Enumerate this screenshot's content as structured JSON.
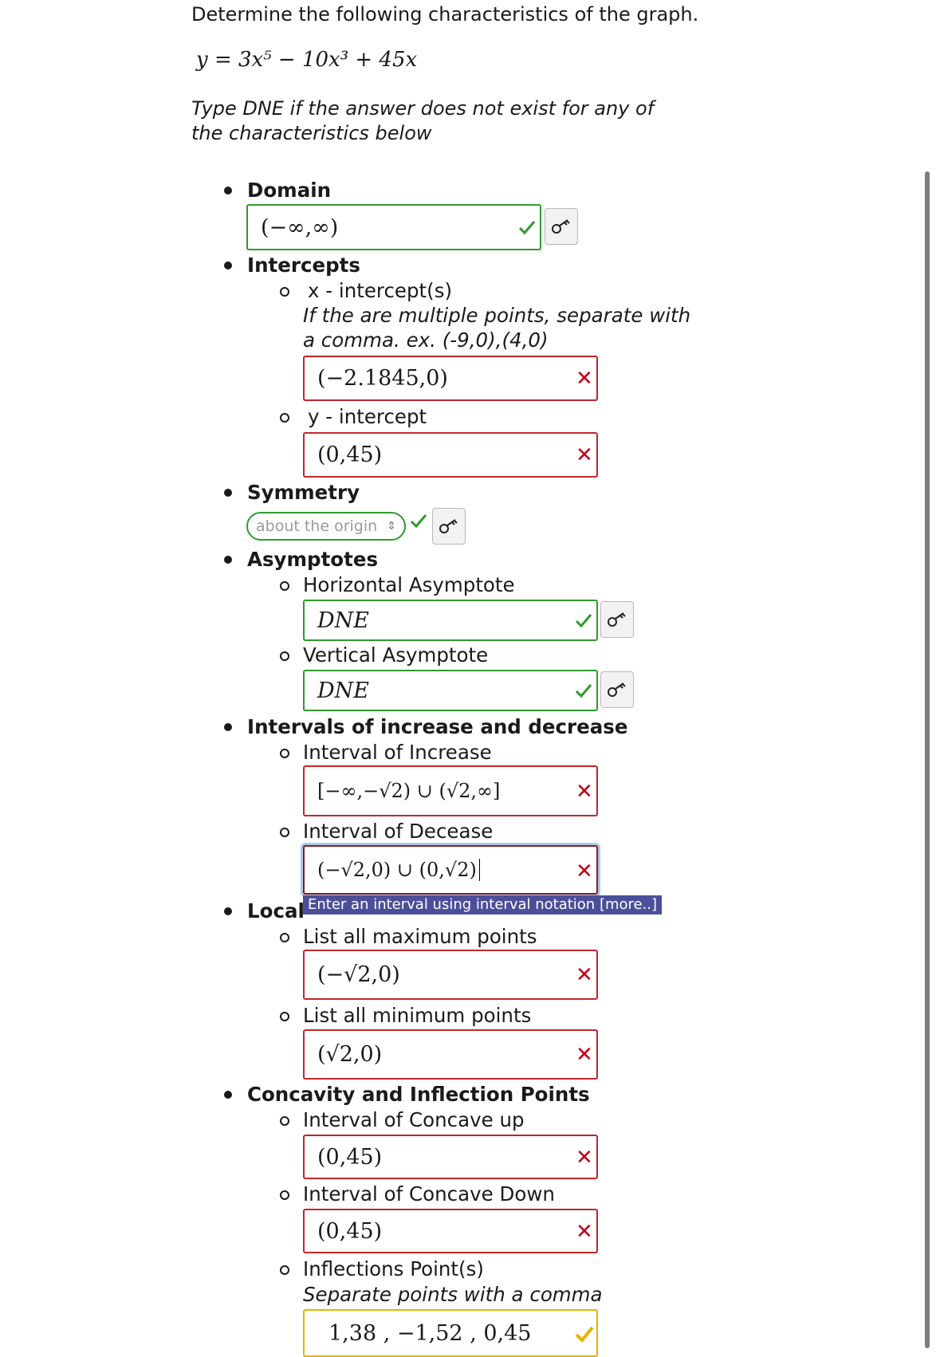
{
  "question": {
    "instruction": "Determine the following characteristics of the graph.",
    "equation": "y = 3x⁵ − 10x³ + 45x",
    "dne_note_line1": "Type DNE if the answer does not exist for any of",
    "dne_note_line2": "the characteristics below"
  },
  "domain": {
    "heading": "Domain",
    "value": "(−∞,∞)",
    "status": "correct"
  },
  "intercepts": {
    "heading": "Intercepts",
    "x_label": "x - intercept(s)",
    "x_hint_line1": "If the are multiple points, separate with",
    "x_hint_line2": "a comma. ex. (-9,0),(4,0)",
    "x_value": "(−2.1845,0)",
    "x_status": "incorrect",
    "y_label": "y - intercept",
    "y_value": "(0,45)",
    "y_status": "incorrect"
  },
  "symmetry": {
    "heading": "Symmetry",
    "selected": "about the origin",
    "status": "correct"
  },
  "asymptotes": {
    "heading": "Asymptotes",
    "horizontal_label": "Horizontal Asymptote",
    "horizontal_value": "DNE",
    "vertical_label": "Vertical Asymptote",
    "vertical_value": "DNE"
  },
  "intervals": {
    "heading": "Intervals of increase and decrease",
    "increase_label": "Interval of Increase",
    "increase_value": "[−∞,−√2) ∪ (√2,∞]",
    "decrease_label": "Interval of Decease",
    "decrease_value": "(−√2,0) ∪ (0,√2)"
  },
  "tooltip": "Enter an interval using interval notation [more..]",
  "local": {
    "heading": "Local",
    "max_label": "List all maximum points",
    "max_value": "(−√2,0)",
    "min_label": "List all minimum points",
    "min_value": "(√2,0)"
  },
  "concavity": {
    "heading": "Concavity and Inflection Points",
    "up_label": "Interval of Concave up",
    "up_value": "(0,45)",
    "down_label": "Interval of Concave Down",
    "down_value": "(0,45)",
    "inflection_label": "Inflections Point(s)",
    "inflection_hint": "Separate points with a comma",
    "inflection_value": "1,38 ,  −1,52 ,  0,45"
  },
  "colors": {
    "correct": "#2e9b2e",
    "incorrect": "#c0001a",
    "partial": "#e8b200",
    "tooltip_bg": "#4b4f9a"
  },
  "icons": {
    "key": "key-icon",
    "check": "check-icon",
    "cross": "cross-icon"
  }
}
